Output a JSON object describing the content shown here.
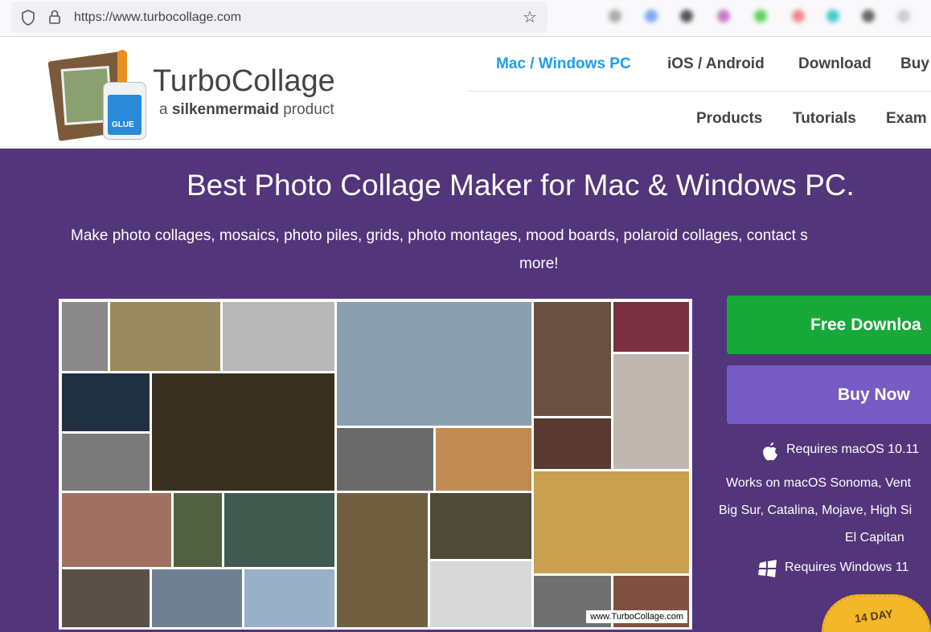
{
  "browser": {
    "url": "https://www.turbocollage.com"
  },
  "header": {
    "brand": "TurboCollage",
    "tagline_prefix": "a",
    "tagline_bold": "silkenmermaid",
    "tagline_suffix": "product",
    "logo_label": "GLUE",
    "nav_top": [
      "Mac / Windows PC",
      "iOS / Android",
      "Download",
      "Buy"
    ],
    "nav_bottom": [
      "Products",
      "Tutorials",
      "Exam"
    ]
  },
  "hero": {
    "title": "Best Photo Collage Maker for Mac & Windows PC.",
    "subtitle_line1": "Make photo collages, mosaics, photo piles, grids, photo montages, mood boards, polaroid collages, contact s",
    "subtitle_line2": "more!",
    "watermark": "www.TurboCollage.com",
    "free_download": "Free Downloa",
    "buy_now": "Buy Now",
    "mac_req": "Requires macOS 10.11",
    "works_on_1": "Works on macOS Sonoma, Vent",
    "works_on_2": "Big Sur, Catalina, Mojave, High Si",
    "works_on_3": "El Capitan",
    "win_req": "Requires Windows  11",
    "seal": "14 DAY"
  },
  "colors": {
    "hero_bg": "#52357a",
    "accent": "#1a9ef0",
    "green": "#17a83a",
    "purple_btn": "#775bc4"
  }
}
